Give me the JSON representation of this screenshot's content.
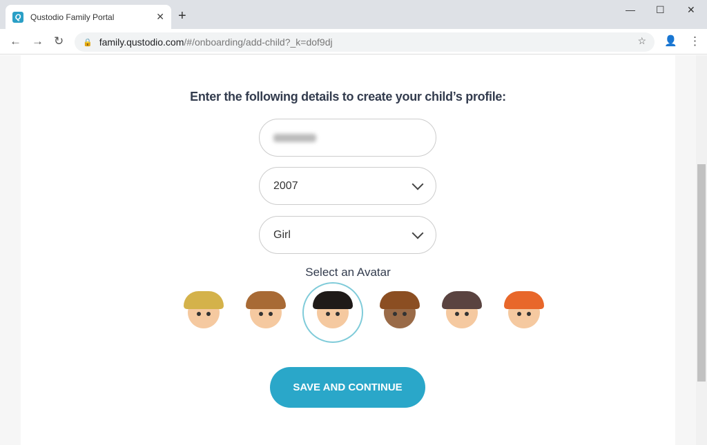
{
  "browser": {
    "tab_title": "Qustodio Family Portal",
    "favicon": "Q",
    "url_host": "family.qustodio.com",
    "url_path": "/#/onboarding/add-child?_k=dof9dj"
  },
  "form": {
    "heading": "Enter the following details to create your child’s profile:",
    "year": "2007",
    "gender": "Girl",
    "avatar_label": "Select an Avatar",
    "submit": "SAVE AND CONTINUE"
  },
  "avatars": [
    {
      "hair": "#d4b24a",
      "skin": "#f5c9a0"
    },
    {
      "hair": "#a86a35",
      "skin": "#f5c9a0"
    },
    {
      "hair": "#1f1a18",
      "skin": "#f5c9a0",
      "selected": true
    },
    {
      "hair": "#8b4e22",
      "skin": "#9a6b48"
    },
    {
      "hair": "#5a4340",
      "skin": "#f5c9a0"
    },
    {
      "hair": "#e8672a",
      "skin": "#f5c9a0"
    }
  ],
  "colors": {
    "accent": "#2aa7c9",
    "selected_ring": "#7fcbd9"
  }
}
